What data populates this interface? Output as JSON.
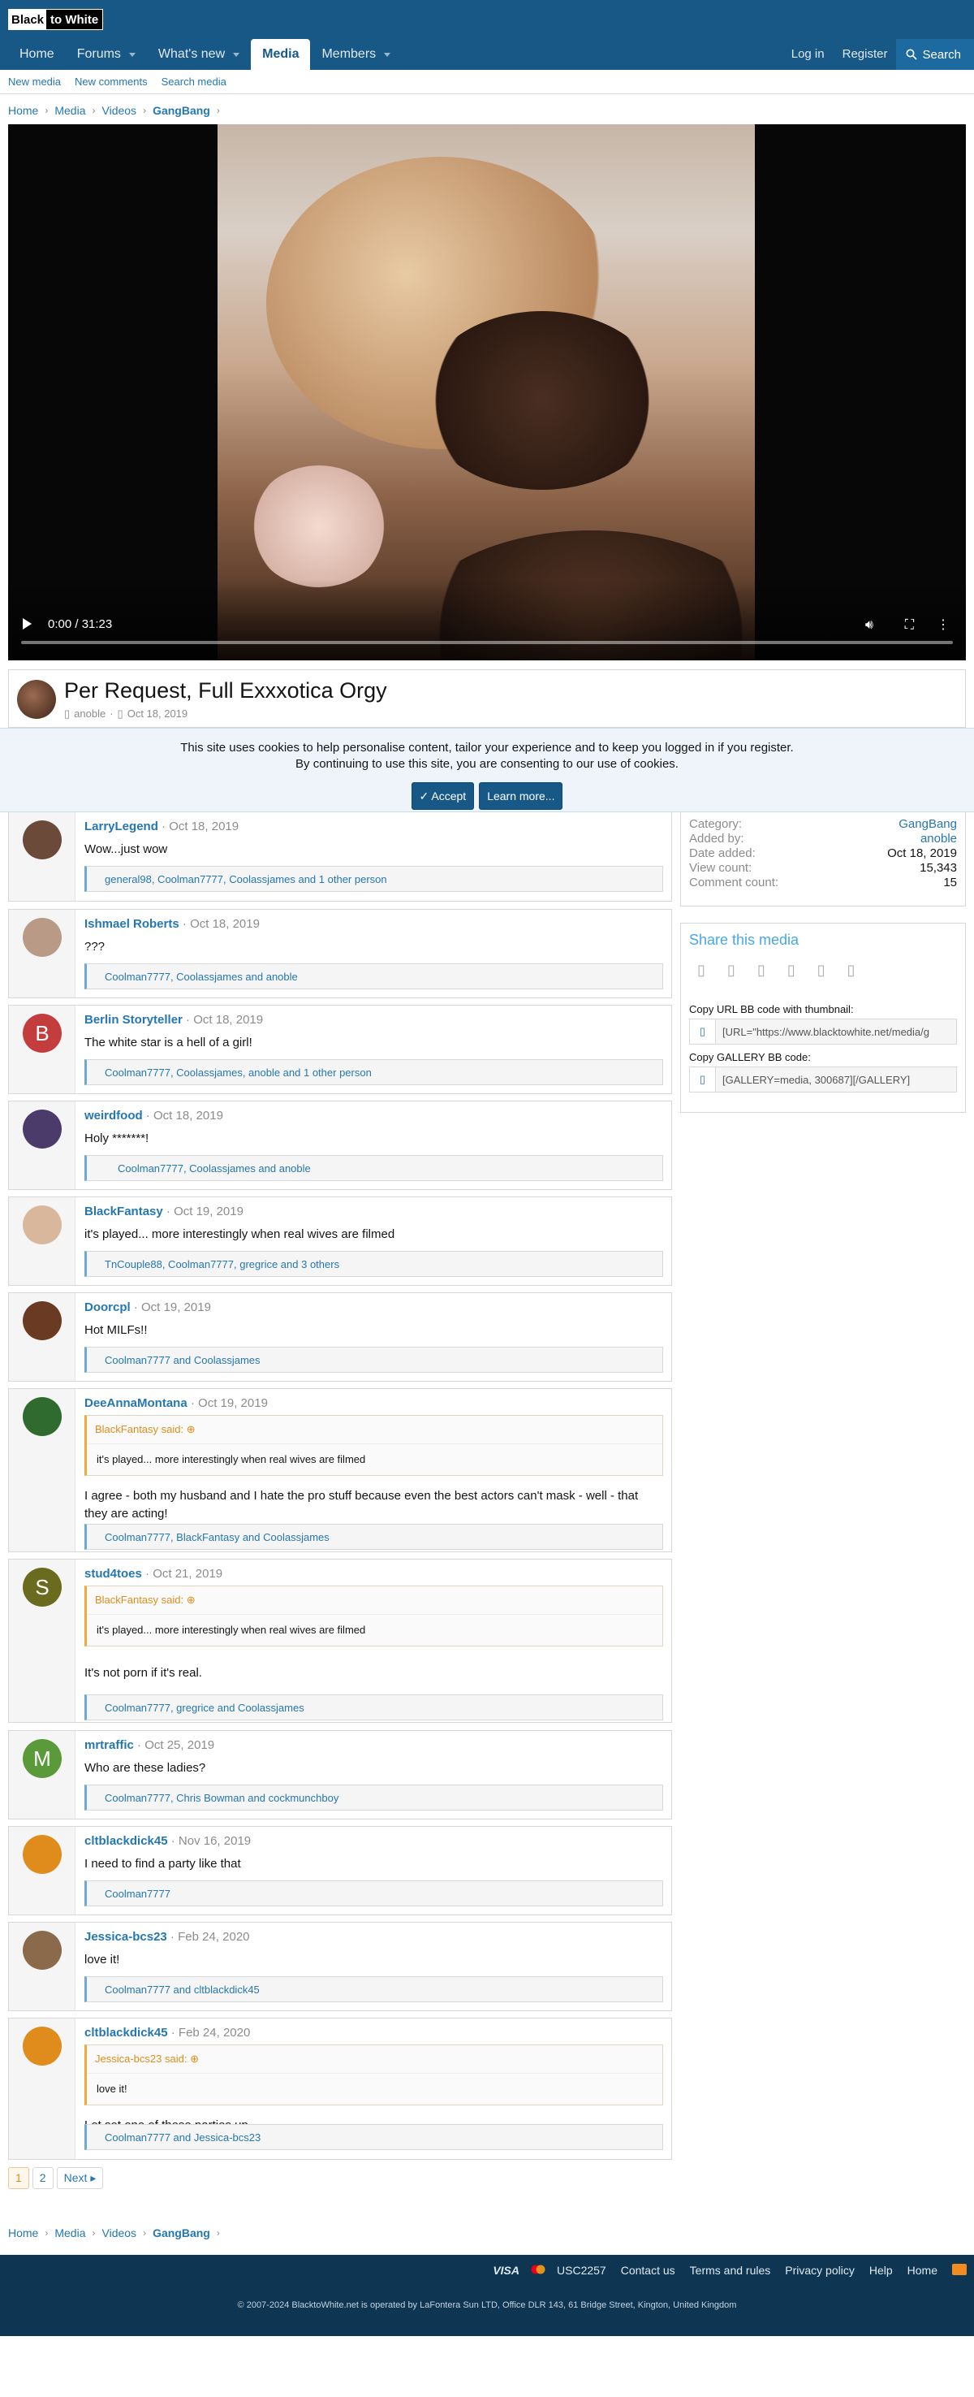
{
  "header": {
    "logo_left": "Black",
    "logo_right": "to White",
    "nav": [
      {
        "label": "Home",
        "caret": false,
        "selected": false
      },
      {
        "label": "Forums",
        "caret": true,
        "selected": false
      },
      {
        "label": "What's new",
        "caret": true,
        "selected": false
      },
      {
        "label": "Media",
        "caret": false,
        "selected": true
      },
      {
        "label": "Members",
        "caret": true,
        "selected": false
      }
    ],
    "login": "Log in",
    "register": "Register",
    "search": "Search"
  },
  "subnav": [
    "New media",
    "New comments",
    "Search media"
  ],
  "breadcrumb": [
    "Home",
    "Media",
    "Videos",
    "GangBang"
  ],
  "video": {
    "time": "0:00 / 31:23"
  },
  "media": {
    "title": "Per Request, Full Exxxotica Orgy",
    "author": "anoble",
    "date": "Oct 18, 2019"
  },
  "cookie": {
    "line1": "This site uses cookies to help personalise content, tailor your experience and to keep you logged in if you register.",
    "line2": "By continuing to use this site, you are consenting to our use of cookies.",
    "accept": "Accept",
    "learn": "Learn more..."
  },
  "sidebar": {
    "info": [
      {
        "k": "Category:",
        "v": "GangBang",
        "link": true
      },
      {
        "k": "Added by:",
        "v": "anoble",
        "link": true
      },
      {
        "k": "Date added:",
        "v": "Oct 18, 2019",
        "link": false
      },
      {
        "k": "View count:",
        "v": "15,343",
        "link": false
      },
      {
        "k": "Comment count:",
        "v": "15",
        "link": false
      }
    ],
    "share_title": "Share this media",
    "url_label": "Copy URL BB code with thumbnail:",
    "url_code": "[URL=\"https://www.blacktowhite.net/media/g",
    "gallery_label": "Copy GALLERY BB code:",
    "gallery_code": "[GALLERY=media, 300687][/GALLERY]"
  },
  "comments": [
    {
      "user": "LarryLegend",
      "date": "Oct 18, 2019",
      "text": "Wow...just wow",
      "reactions": "general98, Coolman7777, Coolassjames and 1 other person",
      "avatar": "#6b4a3a",
      "letter": ""
    },
    {
      "user": "Ishmael Roberts",
      "date": "Oct 18, 2019",
      "text": "???",
      "reactions": "Coolman7777, Coolassjames and anoble",
      "avatar": "#b89a86",
      "letter": ""
    },
    {
      "user": "Berlin Storyteller",
      "date": "Oct 18, 2019",
      "text": "The white star is a hell of a girl!",
      "reactions": "Coolman7777, Coolassjames, anoble and 1 other person",
      "avatar": "#c33d3d",
      "letter": "B"
    },
    {
      "user": "weirdfood",
      "date": "Oct 18, 2019",
      "text": "Holy *******!",
      "reactions": "Coolman7777, Coolassjames and anoble",
      "avatar": "#4a3b6b",
      "letter": ""
    },
    {
      "user": "BlackFantasy",
      "date": "Oct 19, 2019",
      "text": "it's played... more interestingly when real wives are filmed",
      "reactions": "TnCouple88, Coolman7777, gregrice and 3 others",
      "avatar": "#d9b79c",
      "letter": ""
    },
    {
      "user": "Doorcpl",
      "date": "Oct 19, 2019",
      "text": "Hot MILFs!!",
      "reactions": "Coolman7777 and Coolassjames",
      "avatar": "#6b3a22",
      "letter": ""
    },
    {
      "user": "DeeAnnaMontana",
      "date": "Oct 19, 2019",
      "quote_user": "BlackFantasy said:",
      "quote": "it's played... more interestingly when real wives are filmed",
      "text": "I agree - both my husband and I hate the pro stuff because even the best actors can't mask - well - that they are acting!",
      "reactions": "Coolman7777, BlackFantasy and Coolassjames",
      "avatar": "#2f6b2f",
      "letter": ""
    },
    {
      "user": "stud4toes",
      "date": "Oct 21, 2019",
      "quote_user": "BlackFantasy said:",
      "quote": "it's played... more interestingly when real wives are filmed",
      "text": "It's not porn if it's real.",
      "reactions": "Coolman7777, gregrice and Coolassjames",
      "avatar": "#6b6b1f",
      "letter": "S"
    },
    {
      "user": "mrtraffic",
      "date": "Oct 25, 2019",
      "text": "Who are these ladies?",
      "reactions": "Coolman7777, Chris Bowman and cockmunchboy",
      "avatar": "#5a9a3a",
      "letter": "M"
    },
    {
      "user": "cltblackdick45",
      "date": "Nov 16, 2019",
      "text": "I need to find a party like that",
      "reactions": "Coolman7777",
      "avatar": "#e08c1c",
      "letter": ""
    },
    {
      "user": "Jessica-bcs23",
      "date": "Feb 24, 2020",
      "text": "love it!",
      "reactions": "Coolman7777 and cltblackdick45",
      "avatar": "#8a6a4a",
      "letter": ""
    },
    {
      "user": "cltblackdick45",
      "date": "Feb 24, 2020",
      "quote_user": "Jessica-bcs23 said:",
      "quote": "love it!",
      "text": "Let set one of these parties up",
      "reactions": "Coolman7777 and Jessica-bcs23",
      "avatar": "#e08c1c",
      "letter": ""
    }
  ],
  "pagination": {
    "pages": [
      "1",
      "2"
    ],
    "next": "Next"
  },
  "footer": {
    "items": [
      "VISA",
      "USC2257",
      "Contact us",
      "Terms and rules",
      "Privacy policy",
      "Help",
      "Home"
    ],
    "copyright": "© 2007-2024 BlacktoWhite.net is operated by LaFontera Sun LTD, Office DLR 143, 61 Bridge Street, Kington, United Kingdom"
  }
}
